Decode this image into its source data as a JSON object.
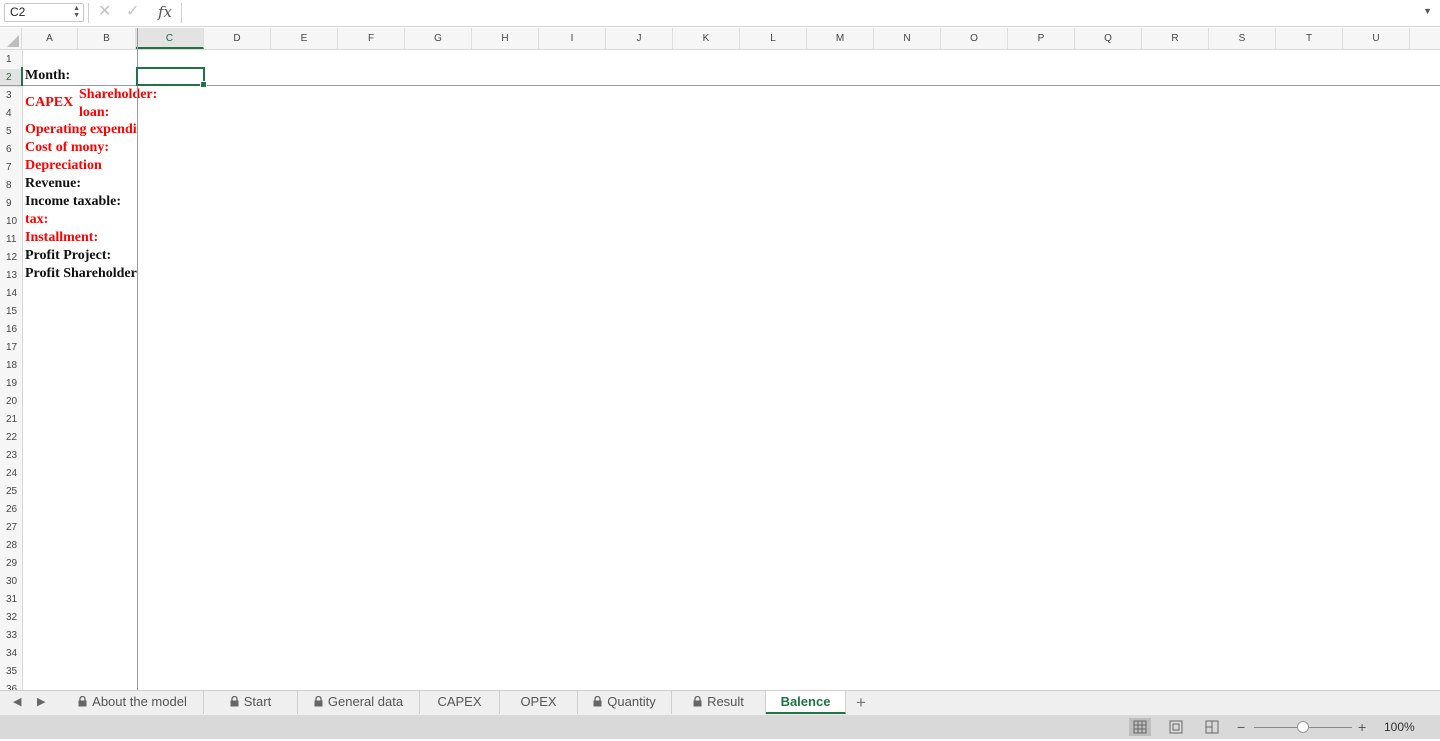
{
  "formula_bar": {
    "name_box": "C2",
    "fx_label": "fx",
    "cancel_glyph": "✕",
    "confirm_glyph": "✓",
    "formula_value": ""
  },
  "columns": [
    "A",
    "B",
    "C",
    "D",
    "E",
    "F",
    "G",
    "H",
    "I",
    "J",
    "K",
    "L",
    "M",
    "N",
    "O",
    "P",
    "Q",
    "R",
    "S",
    "T",
    "U"
  ],
  "selected_column": "C",
  "rows": [
    "1",
    "2",
    "3",
    "4",
    "5",
    "6",
    "7",
    "8",
    "9",
    "10",
    "11",
    "12",
    "13",
    "14",
    "15",
    "16",
    "17",
    "18",
    "19",
    "20",
    "21",
    "22",
    "23",
    "24",
    "25",
    "26",
    "27",
    "28",
    "29",
    "30",
    "31",
    "32",
    "33",
    "34",
    "35",
    "36"
  ],
  "selected_row": "2",
  "cells": {
    "a2": "Month:",
    "a3": "CAPEX",
    "b3": "Shareholder:",
    "b4": "loan:",
    "a5": "Operating expenditure:",
    "a6": "Cost of mony:",
    "a7": "Depreciation",
    "a8": "Revenue:",
    "a9": "Income taxable:",
    "a10": "tax:",
    "a11": "Installment:",
    "a12": "Profit Project:",
    "a13": "Profit Shareholder:"
  },
  "colors": {
    "red_text": "#ff0000",
    "accent_green": "#217346"
  },
  "sheet_tabs": [
    {
      "label": "About the model",
      "locked": true
    },
    {
      "label": "Start",
      "locked": true
    },
    {
      "label": "General data",
      "locked": true
    },
    {
      "label": "CAPEX",
      "locked": false
    },
    {
      "label": "OPEX",
      "locked": false
    },
    {
      "label": "Quantity",
      "locked": true
    },
    {
      "label": "Result",
      "locked": true
    },
    {
      "label": "Balence",
      "locked": false,
      "active": true
    }
  ],
  "add_sheet_label": "+",
  "status_bar": {
    "zoom_minus": "−",
    "zoom_plus": "+",
    "zoom_percent": "100%",
    "zoom_level": 100
  }
}
